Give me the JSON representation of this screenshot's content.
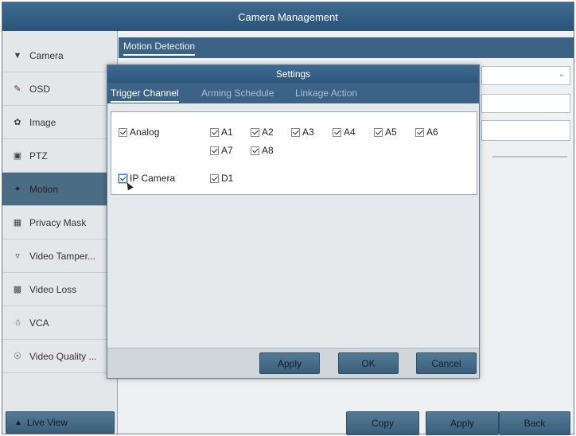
{
  "window": {
    "title": "Camera Management"
  },
  "sidebar": {
    "items": [
      {
        "label": "Camera",
        "icon": "camera-icon",
        "active": false
      },
      {
        "label": "OSD",
        "icon": "osd-icon",
        "active": false
      },
      {
        "label": "Image",
        "icon": "image-icon",
        "active": false
      },
      {
        "label": "PTZ",
        "icon": "ptz-icon",
        "active": false
      },
      {
        "label": "Motion",
        "icon": "motion-icon",
        "active": true
      },
      {
        "label": "Privacy Mask",
        "icon": "privacy-mask-icon",
        "active": false
      },
      {
        "label": "Video Tamper...",
        "icon": "video-tamper-icon",
        "active": false
      },
      {
        "label": "Video Loss",
        "icon": "video-loss-icon",
        "active": false
      },
      {
        "label": "VCA",
        "icon": "vca-icon",
        "active": false
      },
      {
        "label": "Video Quality ...",
        "icon": "video-quality-icon",
        "active": false
      }
    ],
    "live_view": {
      "label": "Live View",
      "icon": "home-icon"
    }
  },
  "main": {
    "tab": "Motion Detection",
    "buttons": {
      "copy": "Copy",
      "apply": "Apply",
      "back": "Back"
    }
  },
  "dialog": {
    "title": "Settings",
    "tabs": [
      {
        "label": "Trigger Channel",
        "active": true
      },
      {
        "label": "Arming Schedule",
        "active": false
      },
      {
        "label": "Linkage Action",
        "active": false
      }
    ],
    "analog": {
      "label": "Analog",
      "checked": true,
      "channels": [
        {
          "label": "A1",
          "checked": true
        },
        {
          "label": "A2",
          "checked": true
        },
        {
          "label": "A3",
          "checked": true
        },
        {
          "label": "A4",
          "checked": true
        },
        {
          "label": "A5",
          "checked": true
        },
        {
          "label": "A6",
          "checked": true
        },
        {
          "label": "A7",
          "checked": true
        },
        {
          "label": "A8",
          "checked": true
        }
      ]
    },
    "ip_camera": {
      "label": "IP Camera",
      "checked": true,
      "channels": [
        {
          "label": "D1",
          "checked": true
        }
      ]
    },
    "buttons": {
      "apply": "Apply",
      "ok": "OK",
      "cancel": "Cancel"
    }
  },
  "colors": {
    "title_bar": "#2c5378",
    "accent": "#3c6386",
    "active_item": "#4b6c85",
    "button": "#3a5f7c"
  }
}
